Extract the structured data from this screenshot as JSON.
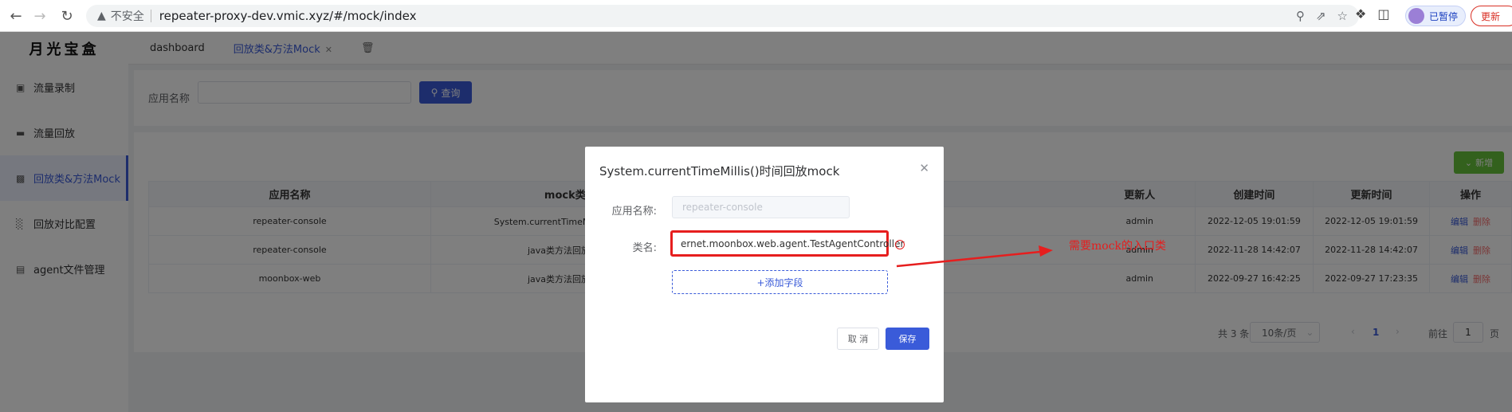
{
  "browser": {
    "insecure_label": "不安全",
    "url": "repeater-proxy-dev.vmic.xyz/#/mock/index",
    "profile_label": "已暂停",
    "update_label": "更新"
  },
  "sidebar": {
    "logo": "月光宝盒",
    "items": [
      {
        "label": "流量录制",
        "icon": "record-icon"
      },
      {
        "label": "流量回放",
        "icon": "monitor-icon"
      },
      {
        "label": "回放类&方法Mock",
        "icon": "puzzle-icon"
      },
      {
        "label": "回放对比配置",
        "icon": "bar-chart-icon"
      },
      {
        "label": "agent文件管理",
        "icon": "clipboard-icon"
      }
    ]
  },
  "tabs": [
    {
      "label": "dashboard"
    },
    {
      "label": "回放类&方法Mock"
    }
  ],
  "search": {
    "label": "应用名称",
    "button": "查询"
  },
  "toolbar": {
    "add_label": "新增"
  },
  "table": {
    "headers": [
      "应用名称",
      "mock类型",
      "",
      "更新人",
      "创建时间",
      "更新时间",
      "操作"
    ],
    "rows": [
      {
        "app": "repeater-console",
        "type": "System.currentTimeMillis()时间回放",
        "user": "admin",
        "created": "2022-12-05 19:01:59",
        "updated": "2022-12-05 19:01:59",
        "edit": "编辑",
        "del": "删除"
      },
      {
        "app": "repeater-console",
        "type": "java类方法回放Mock",
        "user": "admin",
        "created": "2022-11-28 14:42:07",
        "updated": "2022-11-28 14:42:07",
        "edit": "编辑",
        "del": "删除"
      },
      {
        "app": "moonbox-web",
        "type": "java类方法回放Mock",
        "user": "admin",
        "created": "2022-09-27 16:42:25",
        "updated": "2022-09-27 17:23:35",
        "edit": "编辑",
        "del": "删除"
      }
    ]
  },
  "pagination": {
    "total": "共 3 条",
    "page_size": "10条/页",
    "current": "1",
    "goto_label": "前往",
    "goto_value": "1",
    "page_suffix": "页"
  },
  "dialog": {
    "title": "System.currentTimeMillis()时间回放mock",
    "app_label": "应用名称:",
    "app_value": "repeater-console",
    "class_label": "类名:",
    "class_value": "ernet.moonbox.web.agent.TestAgentController",
    "add_field": "+添加字段",
    "cancel": "取 消",
    "save": "保存"
  },
  "annotation": {
    "text": "需要mock的入口类",
    "color": "#e61e1e"
  },
  "colors": {
    "primary": "#3a5bd9",
    "success": "#67c23a",
    "danger": "#f56c6c"
  }
}
